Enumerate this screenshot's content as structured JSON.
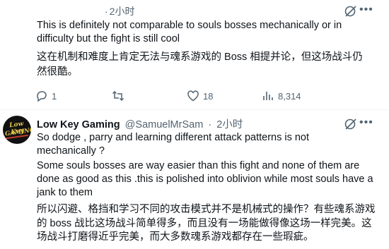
{
  "post1": {
    "time": "2小时",
    "text_en": "This is definitely not comparable to souls bosses mechanically or in difficulty but the fight is still cool",
    "text_zh": "这在机制和难度上肯定无法与魂系游戏的 Boss 相提并论，但这场战斗仍然很酷。",
    "actions": {
      "replies": "1",
      "reposts": "",
      "likes": "18",
      "views": "8,314"
    },
    "icons": [
      "reply-icon",
      "repost-icon",
      "like-icon",
      "views-icon",
      "grok-icon",
      "more-icon"
    ]
  },
  "post2": {
    "display_name": "Low Key Gaming",
    "handle": "@SamuelMrSam",
    "time": "2小时",
    "avatar_text_top": "Low Key",
    "avatar_text_bottom": "GAMING",
    "para1": "So dodge , parry and learning different attack patterns is not mechanically ?",
    "para2": "Some souls bosses are way easier than this fight and none of them are done as good as this .this is polished into oblivion while most souls have a jank to them",
    "para3": "所以闪避、格挡和学习不同的攻击模式并不是机械式的操作？有些魂系游戏的 boss 战比这场战斗简单得多，而且没有一场能做得像这场一样完美。这场战斗打磨得近乎完美，而大多数魂系游戏都存在一些瑕疵。"
  },
  "colors": {
    "text": "#0f1419",
    "secondary": "#536471",
    "divider": "#eff3f4",
    "avatar_bg": "#111111",
    "avatar_gold": "#e5c54a"
  }
}
